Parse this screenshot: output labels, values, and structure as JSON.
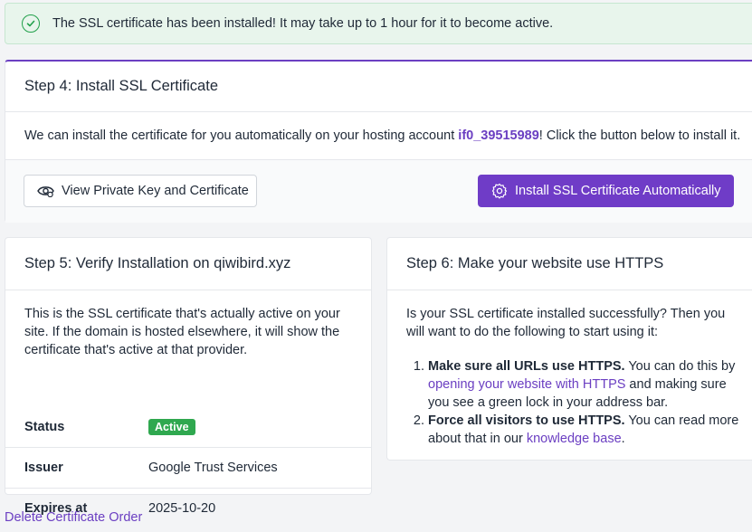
{
  "alert": {
    "message": "The SSL certificate has been installed! It may take up to 1 hour for it to become active."
  },
  "step4": {
    "title": "Step 4: Install SSL Certificate",
    "text_before": "We can install the certificate for you automatically on your hosting account ",
    "account": "if0_39515989",
    "text_after": "! Click the button below to install it.",
    "view_button": "View Private Key and Certificate",
    "install_button": "Install SSL Certificate Automatically"
  },
  "step5": {
    "title": "Step 5: Verify Installation on qiwibird.xyz",
    "intro": "This is the SSL certificate that's actually active on your site. If the domain is hosted elsewhere, it will show the certificate that's active at that provider.",
    "rows": [
      {
        "label": "Status",
        "value": "Active"
      },
      {
        "label": "Issuer",
        "value": "Google Trust Services"
      },
      {
        "label": "Expires at",
        "value": "2025-10-20"
      }
    ]
  },
  "step6": {
    "title": "Step 6: Make your website use HTTPS",
    "intro": "Is your SSL certificate installed successfully? Then you will want to do the following to start using it:",
    "item1_bold": "Make sure all URLs use HTTPS.",
    "item1_text": " You can do this by ",
    "item1_link": "opening your website with HTTPS",
    "item1_after": " and making sure you see a green lock in your address bar.",
    "item2_bold": "Force all visitors to use HTTPS.",
    "item2_text": " You can read more about that in our ",
    "item2_link": "knowledge base",
    "item2_after": "."
  },
  "footer": {
    "delete_link": "Delete Certificate Order"
  },
  "colors": {
    "accent": "#6f3cc7",
    "success": "#2fa84f",
    "alert_bg": "#e8f5ec"
  },
  "icons": {
    "alert": "check-circle-icon",
    "view": "eye-icon",
    "install": "gear-icon"
  }
}
